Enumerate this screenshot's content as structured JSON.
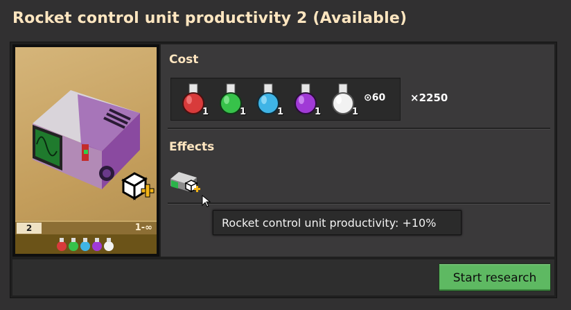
{
  "window": {
    "title": "Rocket control unit productivity 2 (Available)"
  },
  "card": {
    "level": "2",
    "range": "1-∞",
    "icon": "rocket-control-unit-icon",
    "mini_packs": [
      "red",
      "green",
      "blue",
      "purple",
      "white"
    ]
  },
  "cost": {
    "heading": "Cost",
    "packs": [
      {
        "color": "#d83b3b",
        "name": "automation-science-pack-icon",
        "count": "1"
      },
      {
        "color": "#37c24a",
        "name": "logistic-science-pack-icon",
        "count": "1"
      },
      {
        "color": "#3fb4e6",
        "name": "chemical-science-pack-icon",
        "count": "1"
      },
      {
        "color": "#a03ad6",
        "name": "production-science-pack-icon",
        "count": "1"
      },
      {
        "color": "#f2f2f2",
        "name": "utility-science-pack-icon",
        "count": "1"
      }
    ],
    "time": "60",
    "multiplier": "×2250"
  },
  "effects": {
    "heading": "Effects",
    "tooltip": "Rocket control unit productivity: +10%"
  },
  "actions": {
    "start_research": "Start research"
  }
}
